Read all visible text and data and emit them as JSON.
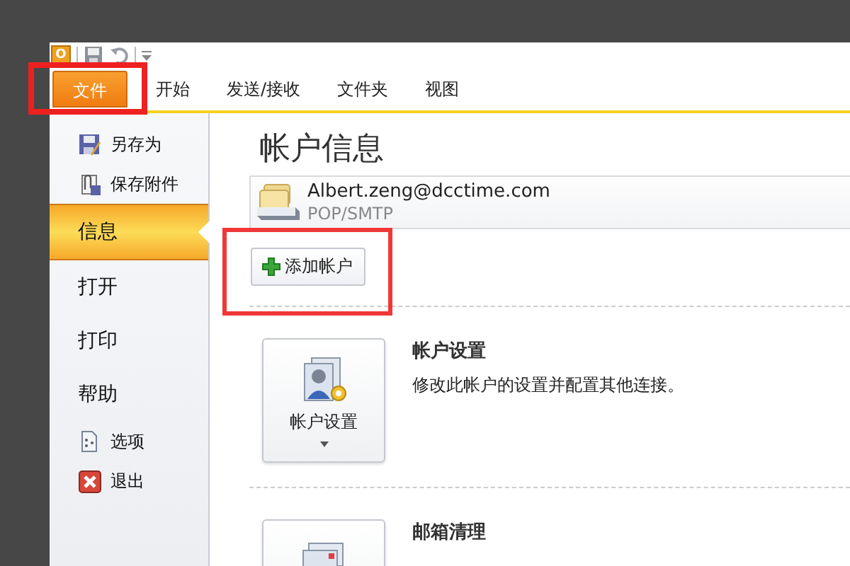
{
  "quick_access": {
    "app_icon": "O"
  },
  "tabs": [
    {
      "label": "文件",
      "selected": true,
      "highlighted": true
    },
    {
      "label": "开始",
      "selected": false,
      "highlighted": false
    },
    {
      "label": "发送/接收",
      "selected": false,
      "highlighted": false
    },
    {
      "label": "文件夹",
      "selected": false,
      "highlighted": false
    },
    {
      "label": "视图",
      "selected": false,
      "highlighted": false
    }
  ],
  "sidebar": {
    "items": [
      {
        "label": "另存为",
        "kind": "command",
        "selected": false
      },
      {
        "label": "保存附件",
        "kind": "command",
        "selected": false
      },
      {
        "label": "信息",
        "kind": "page",
        "selected": true
      },
      {
        "label": "打开",
        "kind": "page",
        "selected": false
      },
      {
        "label": "打印",
        "kind": "page",
        "selected": false
      },
      {
        "label": "帮助",
        "kind": "page",
        "selected": false
      },
      {
        "label": "选项",
        "kind": "command",
        "selected": false
      },
      {
        "label": "退出",
        "kind": "command",
        "selected": false
      }
    ]
  },
  "account_info": {
    "title": "帐户信息",
    "account": {
      "email": "Albert.zeng@dcctime.com",
      "type": "POP/SMTP"
    },
    "add_button": {
      "label": "添加帐户",
      "highlighted": true
    },
    "sections": [
      {
        "button": "帐户设置",
        "title": "帐户设置",
        "description": "修改此帐户的设置并配置其他连接。"
      },
      {
        "title": "邮箱清理"
      }
    ]
  }
}
